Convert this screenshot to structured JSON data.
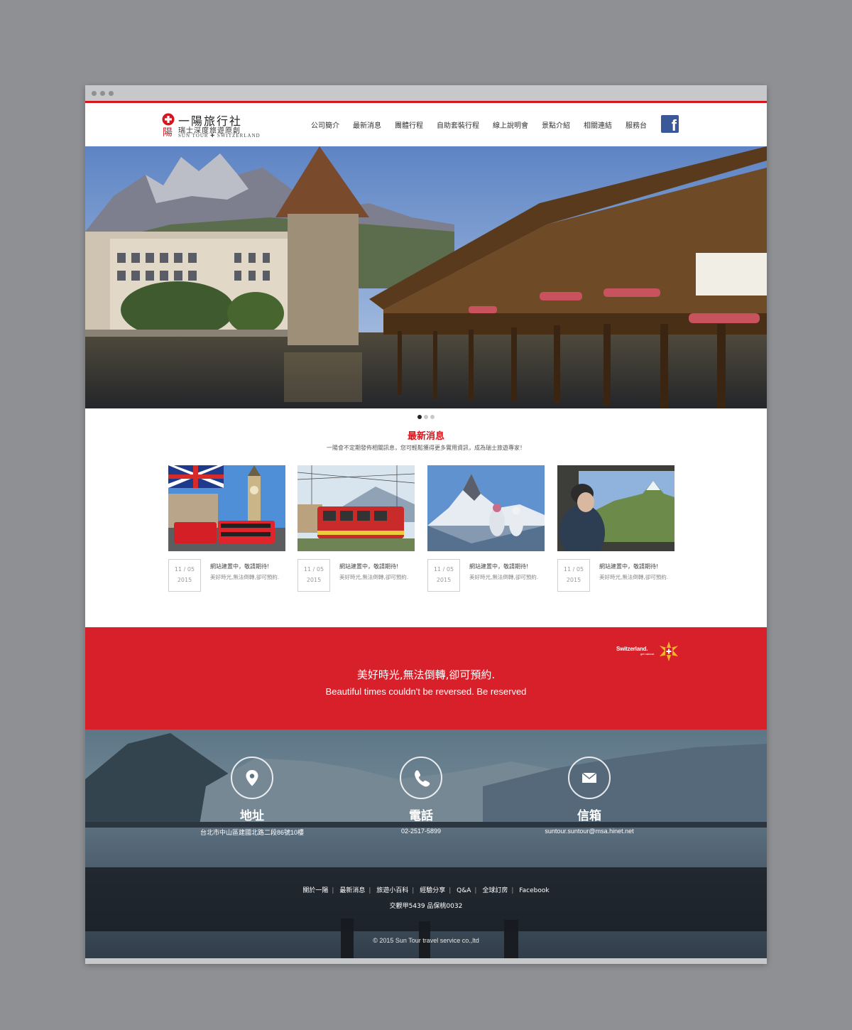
{
  "colors": {
    "brand_red": "#d7202a",
    "nav_accent": "#d6161e",
    "facebook": "#3b5998"
  },
  "logo": {
    "title": "一陽旅行社",
    "subtitle": "瑞士深度旅遊原創",
    "english": "SUN TOUR ✚ SWITZERLAND"
  },
  "nav": {
    "items": [
      "公司簡介",
      "最新消息",
      "團體行程",
      "自助套裝行程",
      "線上說明會",
      "景點介紹",
      "相關連結",
      "服務台"
    ],
    "facebook_icon": "facebook-icon"
  },
  "hero": {
    "slide_count": 3,
    "active_slide": 1
  },
  "news": {
    "heading": "最新消息",
    "intro": "一陽會不定期發佈相關訊息，您可輕鬆獲得更多實用資訊，成為瑞士旅遊專家！",
    "items": [
      {
        "date": "11 / 05",
        "year": "2015",
        "title": "網站建置中，敬請期待!",
        "desc": "美好時光,無法倒轉,卻可預約."
      },
      {
        "date": "11 / 05",
        "year": "2015",
        "title": "網站建置中，敬請期待!",
        "desc": "美好時光,無法倒轉,卻可預約."
      },
      {
        "date": "11 / 05",
        "year": "2015",
        "title": "網站建置中，敬請期待!",
        "desc": "美好時光,無法倒轉,卻可預約."
      },
      {
        "date": "11 / 05",
        "year": "2015",
        "title": "網站建置中，敬請期待!",
        "desc": "美好時光,無法倒轉,卻可預約."
      }
    ]
  },
  "banner": {
    "zh": "美好時光,無法倒轉,卻可預約.",
    "en": "Beautiful times couldn't be reversed. Be reserved",
    "swiss_logo": "Switzerland.",
    "swiss_sub": "get natural."
  },
  "contact": {
    "address": {
      "label": "地址",
      "value": "台北市中山區建國北路二段86號10樓",
      "icon": "map-pin-icon"
    },
    "phone": {
      "label": "電話",
      "value": "02-2517-5899",
      "icon": "phone-icon"
    },
    "email": {
      "label": "信箱",
      "value": "suntour.suntour@msa.hinet.net",
      "icon": "mail-icon"
    }
  },
  "footer": {
    "links": [
      "關於一陽",
      "最新消息",
      "旅遊小百科",
      "經驗分享",
      "Q&A",
      "全球訂房",
      "Facebook"
    ],
    "license": "交觀甲5439 品保桃0032",
    "copyright": "© 2015 Sun Tour travel service co.,ltd"
  }
}
